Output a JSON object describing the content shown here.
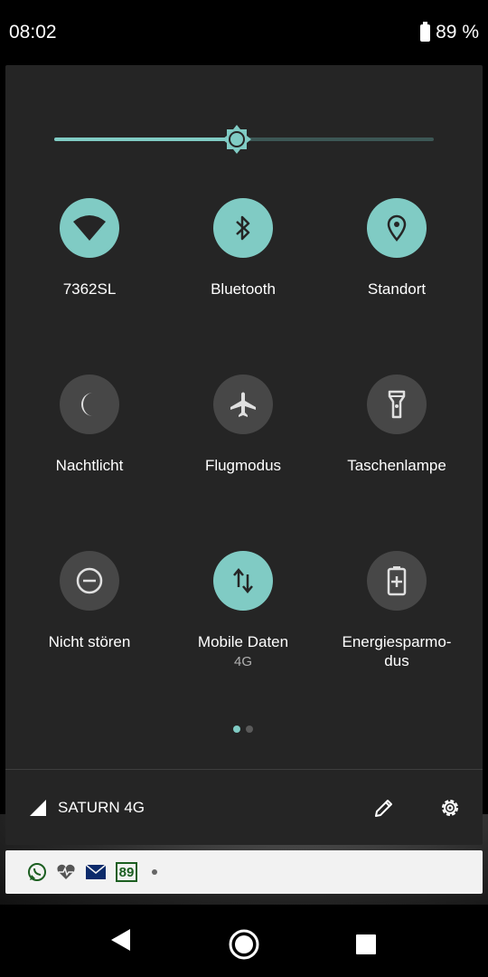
{
  "status_bar": {
    "time": "08:02",
    "battery_text": "89 %"
  },
  "brightness": {
    "level": 0.48,
    "accent": "#80cbc4"
  },
  "tiles": [
    {
      "label": "7362SL",
      "icon": "wifi-icon",
      "state": "on"
    },
    {
      "label": "Bluetooth",
      "icon": "bluetooth-icon",
      "state": "on"
    },
    {
      "label": "Standort",
      "icon": "location-icon",
      "state": "on"
    },
    {
      "label": "Nachtlicht",
      "icon": "moon-icon",
      "state": "off"
    },
    {
      "label": "Flugmodus",
      "icon": "airplane-icon",
      "state": "off"
    },
    {
      "label": "Taschenlampe",
      "icon": "flashlight-icon",
      "state": "off"
    },
    {
      "label": "Nicht stören",
      "icon": "do-not-disturb-icon",
      "state": "off"
    },
    {
      "label": "Mobile Daten",
      "sub": "4G",
      "icon": "mobile-data-icon",
      "state": "on"
    },
    {
      "label": "Energiesparmo-\ndus",
      "icon": "battery-saver-icon",
      "state": "off"
    }
  ],
  "pager": {
    "pages": 2,
    "current": 1
  },
  "footer": {
    "carrier": "SATURN 4G"
  },
  "notifications": {
    "icons": [
      "whatsapp-icon",
      "health-icon",
      "mail-icon",
      "calendar-icon"
    ],
    "calendar_text": "89"
  },
  "navbar": {
    "icons": [
      "back-icon",
      "home-icon",
      "recents-icon"
    ]
  },
  "colors": {
    "tile_on": "#80cbc4",
    "tile_off": "#474747",
    "panel": "#252525"
  }
}
